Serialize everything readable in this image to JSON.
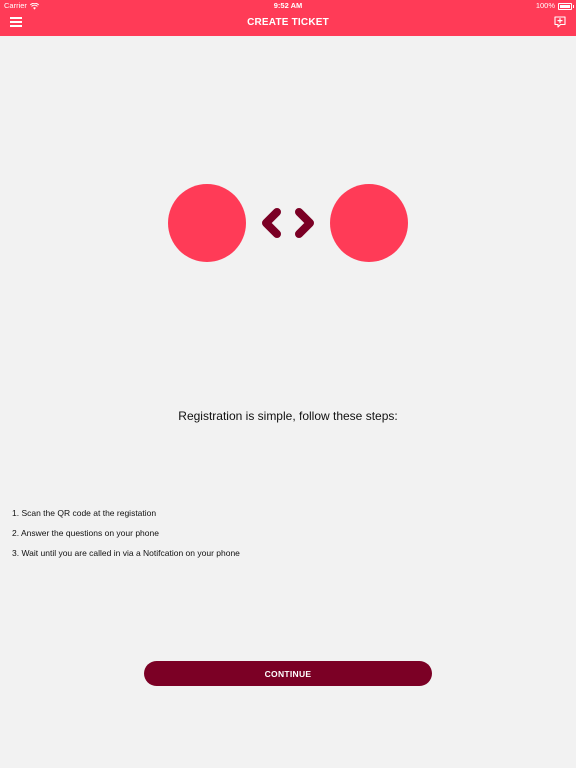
{
  "status_bar": {
    "carrier": "Carrier",
    "time": "9:52 AM",
    "battery": "100%"
  },
  "header": {
    "title": "CREATE TICKET",
    "menu_icon": "hamburger-menu-icon",
    "action_icon": "new-ticket-icon"
  },
  "logo": {
    "circle_color": "#ff3b57",
    "chevron_color": "#7b0025"
  },
  "intro": {
    "text": "Registration is simple, follow these steps:"
  },
  "steps": [
    "1. Scan the QR code at the registation",
    "2. Answer the questions on your phone",
    "3. Wait until you are called in via a Notifcation on your phone"
  ],
  "continue_button": {
    "label": "CONTINUE"
  },
  "colors": {
    "header": "#ff3b57",
    "background": "#f2f2f2",
    "button": "#7b0025"
  }
}
